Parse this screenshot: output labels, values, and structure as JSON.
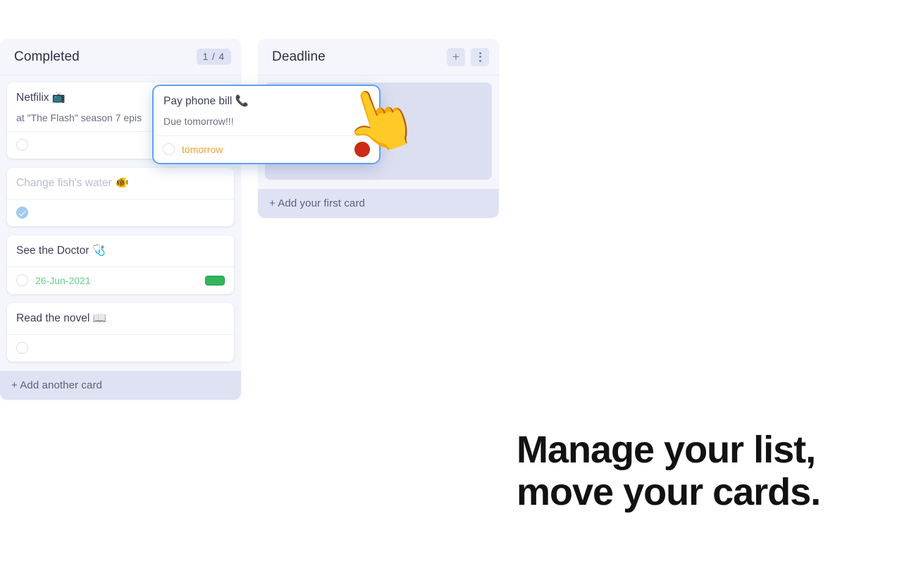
{
  "board": {
    "columns": [
      {
        "name": "completed",
        "title": "Completed",
        "count_badge": "1 / 4",
        "has_count_badge": true,
        "has_action_buttons": false,
        "add_card_label": "+ Add another card",
        "cards": [
          {
            "title": "Netfilix 📺",
            "desc": "at \"The Flash\" season 7 epis",
            "checked": false,
            "date": "",
            "label_color": "",
            "done": false
          },
          {
            "title": "Change fish's water 🐠",
            "desc": "",
            "checked": true,
            "date": "",
            "label_color": "",
            "done": true
          },
          {
            "title": "See the Doctor 🩺",
            "desc": "",
            "checked": false,
            "date": "26-Jun-2021",
            "label_color": "#34b45c",
            "done": false
          },
          {
            "title": "Read the novel 📖",
            "desc": "",
            "checked": false,
            "date": "",
            "label_color": "",
            "done": false
          }
        ]
      },
      {
        "name": "deadline",
        "title": "Deadline",
        "count_badge": "",
        "has_count_badge": false,
        "has_action_buttons": true,
        "add_button_label": "+",
        "menu_button_label": "⋮",
        "add_card_label": "+ Add your first card",
        "cards": []
      }
    ]
  },
  "drag_card": {
    "title": "Pay phone bill 📞",
    "desc": "Due tomorrow!!!",
    "date": "tomorrow",
    "date_color": "#f0a030",
    "dot_color": "#cc2a17",
    "checked": false
  },
  "cursor": {
    "icon": "👆"
  },
  "tagline": {
    "line1": "Manage your list,",
    "line2": "move your cards."
  },
  "colors": {
    "column_bg": "#f4f6fc",
    "badge_bg": "#dfe2f3",
    "placeholder": "#dcdff0",
    "add_card_bg": "#dfe2f2",
    "drag_outline": "#5ea2f5",
    "green": "#34b45c",
    "red": "#cc2a17",
    "orange": "#f0a030"
  }
}
